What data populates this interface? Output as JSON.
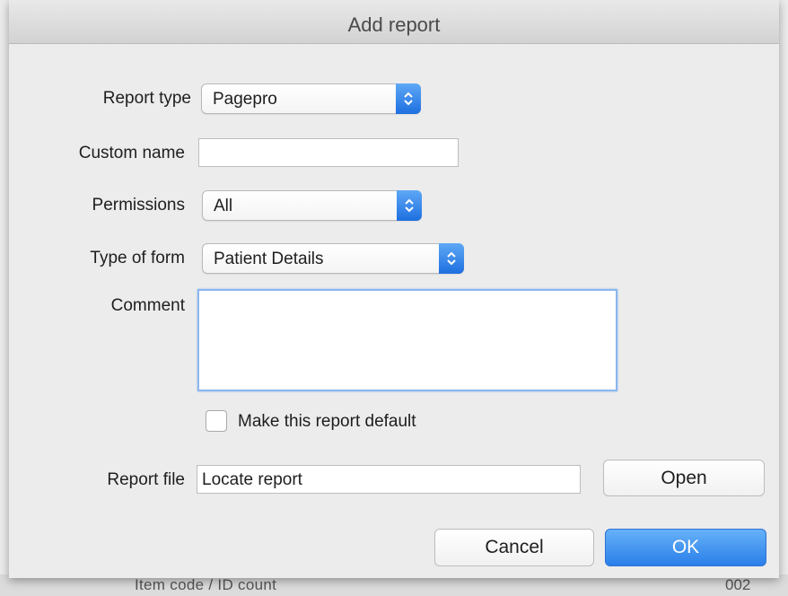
{
  "dialog": {
    "title": "Add report",
    "report_type": {
      "label": "Report type",
      "value": "Pagepro"
    },
    "custom_name": {
      "label": "Custom name",
      "value": ""
    },
    "permissions": {
      "label": "Permissions",
      "value": "All"
    },
    "type_of_form": {
      "label": "Type of form",
      "value": "Patient Details"
    },
    "comment": {
      "label": "Comment",
      "value": ""
    },
    "default_checkbox": {
      "label": "Make this report default",
      "checked": false
    },
    "report_file": {
      "label": "Report file",
      "value": "Locate report",
      "open_label": "Open"
    },
    "buttons": {
      "cancel_label": "Cancel",
      "ok_label": "OK"
    }
  },
  "colors": {
    "accent": "#2a7fe9",
    "focus_ring": "#8cb6ee",
    "dialog_bg": "#ececec"
  },
  "icons": {
    "popup_arrows": "up-down-chevron-icon"
  }
}
